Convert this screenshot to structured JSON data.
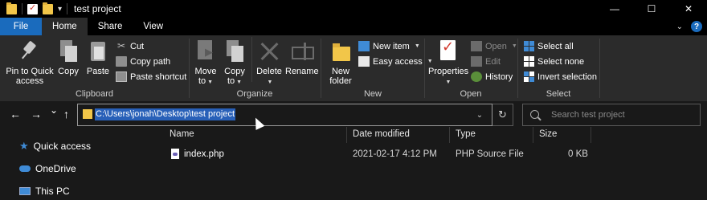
{
  "window": {
    "title": "test project",
    "controls": {
      "minimize": "—",
      "maximize": "☐",
      "close": "✕"
    }
  },
  "tabs": [
    {
      "label": "File",
      "state": "file"
    },
    {
      "label": "Home",
      "state": "active"
    },
    {
      "label": "Share",
      "state": "normal"
    },
    {
      "label": "View",
      "state": "normal"
    }
  ],
  "ribbon": {
    "clipboard": {
      "label": "Clipboard",
      "pin_line1": "Pin to Quick",
      "pin_line2": "access",
      "copy": "Copy",
      "paste": "Paste",
      "cut": "Cut",
      "copy_path": "Copy path",
      "paste_shortcut": "Paste shortcut"
    },
    "organize": {
      "label": "Organize",
      "move_line1": "Move",
      "move_line2": "to",
      "copy_line1": "Copy",
      "copy_line2": "to",
      "delete": "Delete",
      "rename": "Rename"
    },
    "new": {
      "label": "New",
      "new_folder_line1": "New",
      "new_folder_line2": "folder",
      "new_item": "New item",
      "easy_access": "Easy access"
    },
    "open": {
      "label": "Open",
      "properties": "Properties",
      "open": "Open",
      "edit": "Edit",
      "history": "History"
    },
    "select": {
      "label": "Select",
      "select_all": "Select all",
      "select_none": "Select none",
      "invert_selection": "Invert selection"
    }
  },
  "nav": {
    "back": "←",
    "forward": "→",
    "recent": "⌄",
    "up": "↑",
    "address": "C:\\Users\\jonah\\Desktop\\test project",
    "dropdown": "⌄",
    "refresh": "↻",
    "search_placeholder": "Search test project"
  },
  "navpane": {
    "items": [
      {
        "label": "Quick access",
        "icon": "star-icon"
      },
      {
        "label": "OneDrive",
        "icon": "cloud-icon"
      },
      {
        "label": "This PC",
        "icon": "pc-icon"
      }
    ]
  },
  "filelist": {
    "columns": [
      "Name",
      "Date modified",
      "Type",
      "Size"
    ],
    "rows": [
      {
        "name": "index.php",
        "date": "2021-02-17 4:12 PM",
        "type": "PHP Source File",
        "size": "0 KB"
      }
    ]
  },
  "colors": {
    "accent": "#1a6bbd",
    "selection": "#2860b8",
    "background": "#191919",
    "ribbon": "#2b2b2b",
    "folder": "#f2c649"
  }
}
